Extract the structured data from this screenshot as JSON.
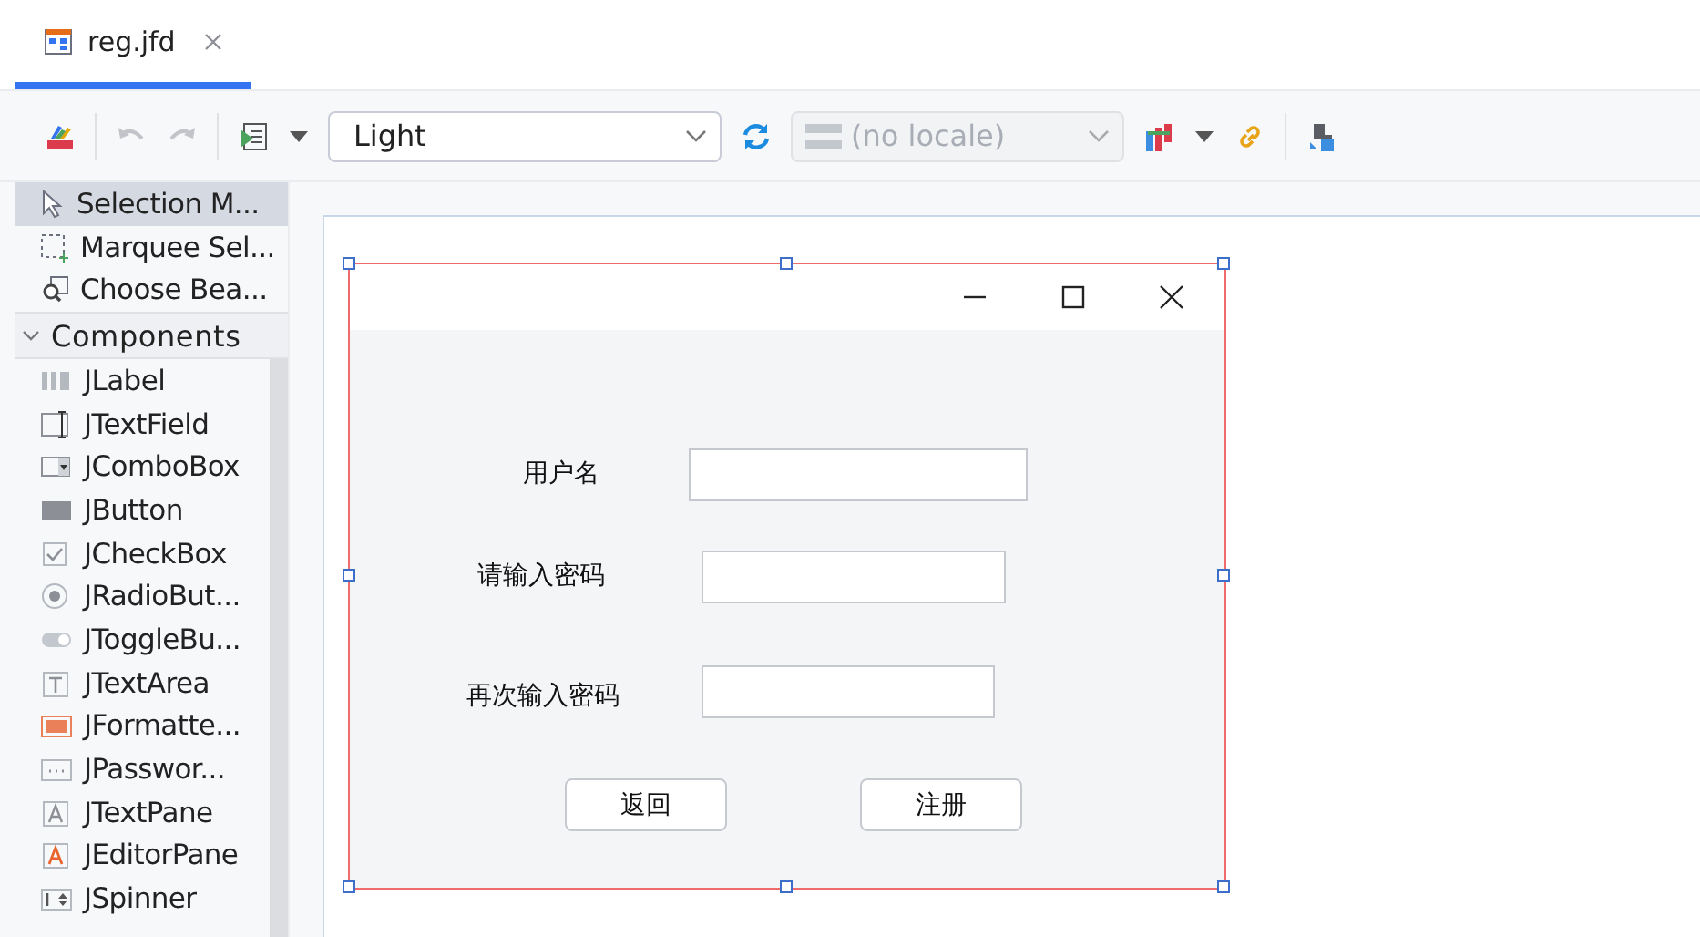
{
  "editor_tabs": [
    {
      "label": "reg.jfd",
      "selected": true
    }
  ],
  "toolbar": {
    "theme": "Light",
    "locale": {
      "value": "(no locale)",
      "disabled": true
    }
  },
  "palette": {
    "tools": [
      {
        "label": "Selection M...",
        "kind": "pointer",
        "selected": true
      },
      {
        "label": "Marquee Sel...",
        "kind": "marquee",
        "selected": false
      },
      {
        "label": "Choose Bea...",
        "kind": "choose",
        "selected": false
      }
    ],
    "group": {
      "label": "Components",
      "expanded": true
    },
    "components": [
      {
        "label": "JLabel",
        "kind": "label"
      },
      {
        "label": "JTextField",
        "kind": "textfield"
      },
      {
        "label": "JComboBox",
        "kind": "combo"
      },
      {
        "label": "JButton",
        "kind": "button"
      },
      {
        "label": "JCheckBox",
        "kind": "checkbox"
      },
      {
        "label": "JRadioBut...",
        "kind": "radio"
      },
      {
        "label": "JToggleBu...",
        "kind": "toggle"
      },
      {
        "label": "JTextArea",
        "kind": "textarea"
      },
      {
        "label": "JFormatte...",
        "kind": "formatted"
      },
      {
        "label": "JPasswor...",
        "kind": "password"
      },
      {
        "label": "JTextPane",
        "kind": "textpane"
      },
      {
        "label": "JEditorPane",
        "kind": "editorpane"
      },
      {
        "label": "JSpinner",
        "kind": "spinner"
      }
    ]
  },
  "form": {
    "selected": true,
    "rows": [
      {
        "label": "用户名"
      },
      {
        "label": "请输入密码"
      },
      {
        "label": "再次输入密码"
      }
    ],
    "buttons": [
      "返回",
      "注册"
    ]
  }
}
